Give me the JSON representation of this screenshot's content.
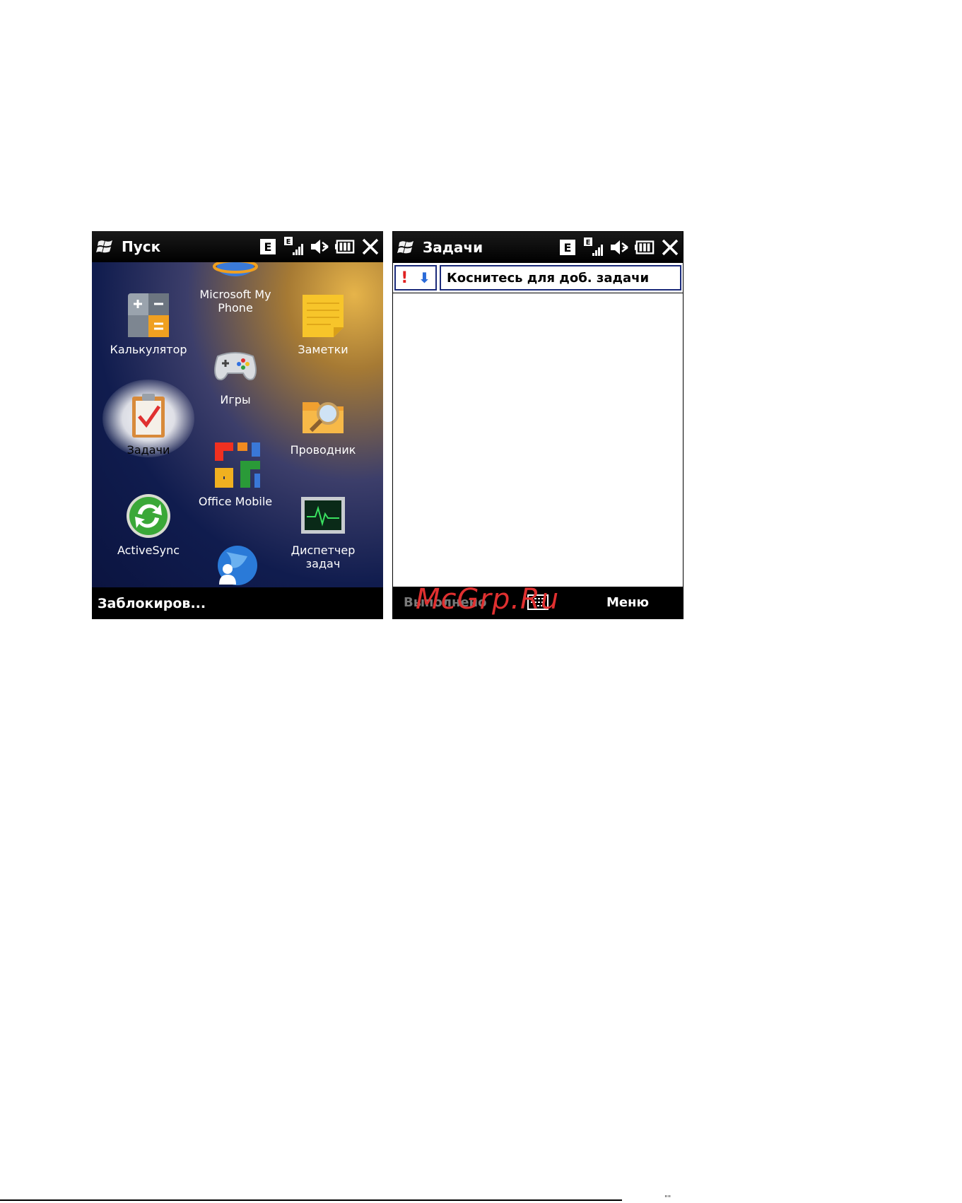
{
  "start_screen": {
    "title": "Пуск",
    "tiles": {
      "my_phone": "Microsoft My\nPhone",
      "calculator": "Калькулятор",
      "notes": "Заметки",
      "games": "Игры",
      "tasks": "Задачи",
      "explorer": "Проводник",
      "office": "Office Mobile",
      "activesync": "ActiveSync",
      "task_manager": "Диспетчер задач"
    },
    "bottom_left": "Заблокиров..."
  },
  "tasks_screen": {
    "title": "Задачи",
    "prio_high": "!",
    "prio_low": "⬇",
    "new_task_prompt": "Коснитесь для доб. задачи",
    "softkey_left": "Выполнено",
    "softkey_right": "Меню"
  },
  "status": {
    "network": "E"
  },
  "watermark": "McGrp.Ru",
  "footer_mark": "\"\""
}
